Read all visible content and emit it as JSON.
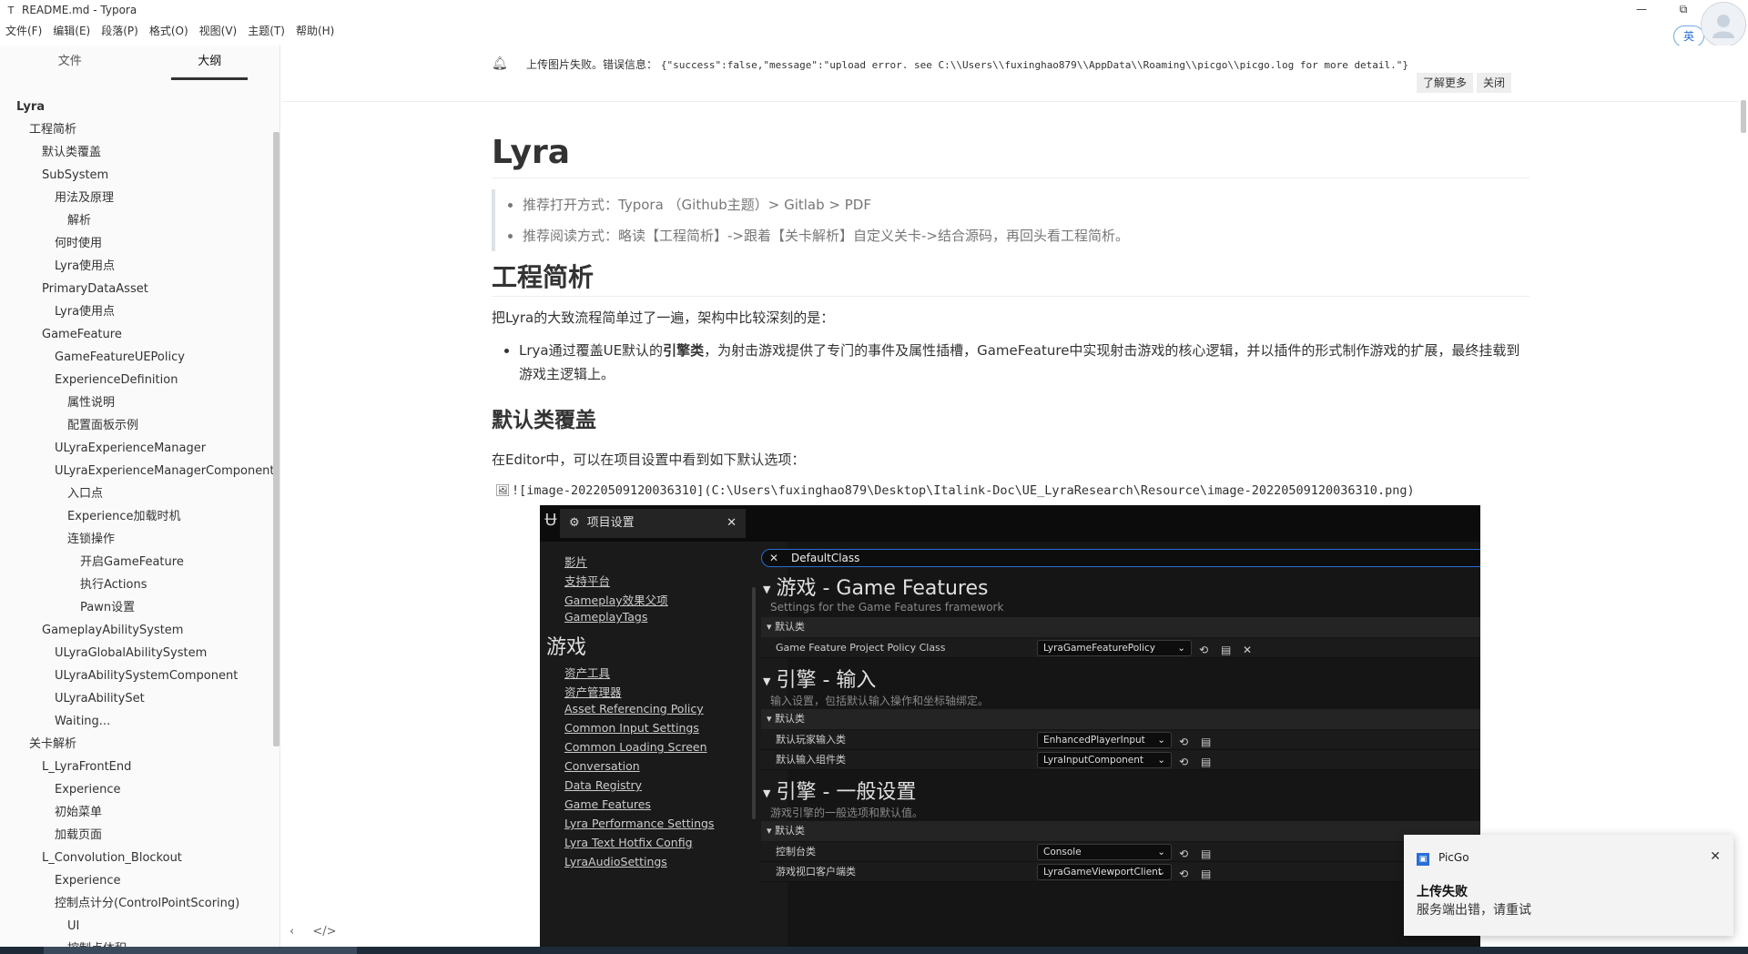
{
  "window": {
    "app_icon": "T",
    "title": "README.md - Typora",
    "minimize": "—",
    "maximize": "⧉",
    "close": "✕"
  },
  "menu": [
    "文件(F)",
    "编辑(E)",
    "段落(P)",
    "格式(O)",
    "视图(V)",
    "主题(T)",
    "帮助(H)"
  ],
  "ime": "英",
  "sidebar": {
    "tabs": [
      "文件",
      "大纲"
    ],
    "active_tab": "大纲",
    "outline": [
      {
        "label": "Lyra",
        "level": 1
      },
      {
        "label": "工程简析",
        "level": 2
      },
      {
        "label": "默认类覆盖",
        "level": 3
      },
      {
        "label": "SubSystem",
        "level": 3
      },
      {
        "label": "用法及原理",
        "level": 4
      },
      {
        "label": "解析",
        "level": 5
      },
      {
        "label": "何时使用",
        "level": 4
      },
      {
        "label": "Lyra使用点",
        "level": 4
      },
      {
        "label": "PrimaryDataAsset",
        "level": 3
      },
      {
        "label": "Lyra使用点",
        "level": 4
      },
      {
        "label": "GameFeature",
        "level": 3
      },
      {
        "label": "GameFeatureUEPolicy",
        "level": 4
      },
      {
        "label": "ExperienceDefinition",
        "level": 4
      },
      {
        "label": "属性说明",
        "level": 5
      },
      {
        "label": "配置面板示例",
        "level": 5
      },
      {
        "label": "ULyraExperienceManager",
        "level": 4
      },
      {
        "label": "ULyraExperienceManagerComponent",
        "level": 4
      },
      {
        "label": "入口点",
        "level": 5
      },
      {
        "label": "Experience加载时机",
        "level": 5
      },
      {
        "label": "连锁操作",
        "level": 5
      },
      {
        "label": "开启GameFeature",
        "level": 6
      },
      {
        "label": "执行Actions",
        "level": 6
      },
      {
        "label": "Pawn设置",
        "level": 6
      },
      {
        "label": "GameplayAbilitySystem",
        "level": 3
      },
      {
        "label": "ULyraGlobalAbilitySystem",
        "level": 4
      },
      {
        "label": "ULyraAbilitySystemComponent",
        "level": 4
      },
      {
        "label": "ULyraAbilitySet",
        "level": 4
      },
      {
        "label": "Waiting...",
        "level": 4
      },
      {
        "label": "关卡解析",
        "level": 2
      },
      {
        "label": "L_LyraFrontEnd",
        "level": 3
      },
      {
        "label": "Experience",
        "level": 4
      },
      {
        "label": "初始菜单",
        "level": 4
      },
      {
        "label": "加载页面",
        "level": 4
      },
      {
        "label": "L_Convolution_Blockout",
        "level": 3
      },
      {
        "label": "Experience",
        "level": 4
      },
      {
        "label": "控制点计分(ControlPointScoring)",
        "level": 4
      },
      {
        "label": "UI",
        "level": 5
      },
      {
        "label": "控制点体积",
        "level": 5
      }
    ],
    "footer": [
      "‹",
      "</>"
    ]
  },
  "banner": {
    "text": "上传图片失败。错误信息：",
    "code": "{\"success\":false,\"message\":\"upload error. see C:\\\\Users\\\\fuxinghao879\\\\AppData\\\\Roaming\\\\picgo\\\\picgo.log for more detail.\"}",
    "learn_more": "了解更多",
    "close": "关闭"
  },
  "doc": {
    "h1": "Lyra",
    "quote": [
      "推荐打开方式：Typora （Github主题）> Gitlab > PDF",
      "推荐阅读方式：略读【工程简析】->跟着【关卡解析】自定义关卡->结合源码，再回头看工程简析。"
    ],
    "h2": "工程简析",
    "p1": "把Lyra的大致流程简单过了一遍，架构中比较深刻的是：",
    "bullet_pre": "Lrya通过覆盖UE默认的",
    "bullet_bold": "引擎类",
    "bullet_post": "，为射击游戏提供了专门的事件及属性插槽，GameFeature中实现射击游戏的核心逻辑，并以插件的形式制作游戏的扩展，最终挂载到游戏主逻辑上。",
    "h3": "默认类覆盖",
    "p2": "在Editor中，可以在项目设置中看到如下默认选项：",
    "image_source": "![image-20220509120036310](C:\\Users\\fuxinghao879\\Desktop\\Italink-Doc\\UE_LyraResearch\\Resource\\image-20220509120036310.png)"
  },
  "ue": {
    "tab_title": "项目设置",
    "left_links_a": [
      "影片",
      "支持平台",
      "Gameplay效果父项",
      "GameplayTags"
    ],
    "section_game": "游戏",
    "left_links_b": [
      "资产工具",
      "资产管理器",
      "Asset Referencing Policy",
      "Common Input Settings",
      "Common Loading Screen",
      "Conversation",
      "Data Registry",
      "Game Features",
      "Lyra Performance Settings",
      "Lyra Text Hotfix Config",
      "LyraAudioSettings"
    ],
    "search_value": "DefaultClass",
    "groups": [
      {
        "title": "游戏 - Game Features",
        "subtitle": "Settings for the Game Features framework",
        "category": "默认类",
        "rows": [
          {
            "label": "Game Feature Project Policy Class",
            "value": "LyraGameFeaturePolicy"
          }
        ]
      },
      {
        "title": "引擎 - 输入",
        "subtitle": "输入设置，包括默认输入操作和坐标轴绑定。",
        "category": "默认类",
        "rows": [
          {
            "label": "默认玩家输入类",
            "value": "EnhancedPlayerInput"
          },
          {
            "label": "默认输入组件类",
            "value": "LyraInputComponent"
          }
        ]
      },
      {
        "title": "引擎 - 一般设置",
        "subtitle": "游戏引擎的一般选项和默认值。",
        "category": "默认类",
        "rows": [
          {
            "label": "控制台类",
            "value": "Console"
          },
          {
            "label": "游戏视口客户端类",
            "value": "LyraGameViewportClient"
          }
        ]
      }
    ]
  },
  "toast": {
    "app": "PicGo",
    "title": "上传失败",
    "body": "服务端出错，请重试",
    "close": "✕"
  }
}
